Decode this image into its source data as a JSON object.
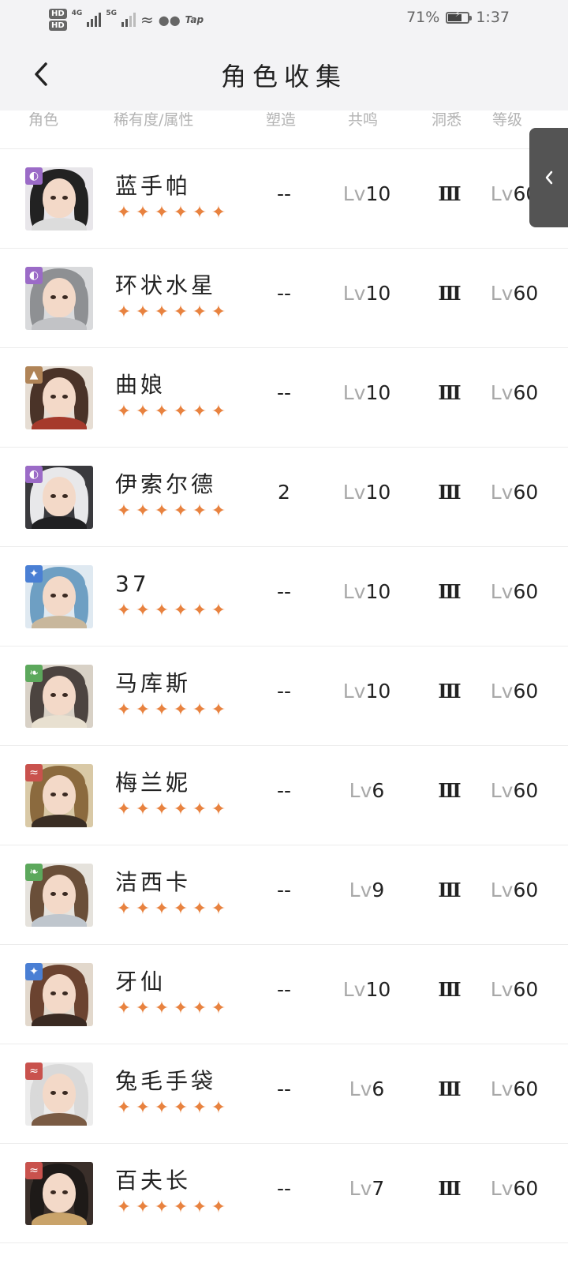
{
  "status_bar": {
    "hd1": "HD",
    "hd2": "HD",
    "net1": "4G",
    "net2": "5G",
    "tap": "Tap",
    "battery_level_percent": 71,
    "battery": "71%",
    "time": "1:37"
  },
  "nav": {
    "title": "角色收集",
    "back_icon": "chevron-left-icon"
  },
  "columns": {
    "role": "角色",
    "rarity": "稀有度/属性",
    "shape": "塑造",
    "resonance": "共鸣",
    "cave": "洞悉",
    "level": "等级"
  },
  "side_tab": {
    "icon": "chevron-left-icon"
  },
  "characters": [
    {
      "name": "蓝手帕",
      "element": "purple",
      "element_color": "#9b6bc7",
      "element_icon": "swirl-icon",
      "stars": "★★★★★★",
      "shaping": "--",
      "res_prefix": "Lv",
      "resonance": "10",
      "insight": "Ⅲ",
      "lv_prefix": "Lv",
      "level": "60",
      "palette": {
        "bg": "#e8e6ea",
        "hair": "#222222",
        "body": "#dcdcdc"
      }
    },
    {
      "name": "环状水星",
      "element": "purple",
      "element_color": "#9b6bc7",
      "element_icon": "swirl-icon",
      "stars": "★★★★★★",
      "shaping": "--",
      "res_prefix": "Lv",
      "resonance": "10",
      "insight": "Ⅲ",
      "lv_prefix": "Lv",
      "level": "60",
      "palette": {
        "bg": "#d9dadc",
        "hair": "#8e9093",
        "body": "#c2c3c6"
      }
    },
    {
      "name": "曲娘",
      "element": "brown",
      "element_color": "#b08457",
      "element_icon": "mountain-icon",
      "stars": "★★★★★★",
      "shaping": "--",
      "res_prefix": "Lv",
      "resonance": "10",
      "insight": "Ⅲ",
      "lv_prefix": "Lv",
      "level": "60",
      "palette": {
        "bg": "#e6ddd3",
        "hair": "#4a3328",
        "body": "#a63a2c"
      }
    },
    {
      "name": "伊索尔德",
      "element": "purple",
      "element_color": "#9b6bc7",
      "element_icon": "swirl-icon",
      "stars": "★★★★★★",
      "shaping": "2",
      "res_prefix": "Lv",
      "resonance": "10",
      "insight": "Ⅲ",
      "lv_prefix": "Lv",
      "level": "60",
      "palette": {
        "bg": "#3a3a3e",
        "hair": "#e8e8ea",
        "body": "#202022"
      }
    },
    {
      "name": "37",
      "element": "blue",
      "element_color": "#4a7fd4",
      "element_icon": "star-burst-icon",
      "stars": "★★★★★★",
      "shaping": "--",
      "res_prefix": "Lv",
      "resonance": "10",
      "insight": "Ⅲ",
      "lv_prefix": "Lv",
      "level": "60",
      "palette": {
        "bg": "#dfe9f1",
        "hair": "#6e9fc3",
        "body": "#c8b79c"
      }
    },
    {
      "name": "马库斯",
      "element": "green",
      "element_color": "#5ca85c",
      "element_icon": "leaf-icon",
      "stars": "★★★★★★",
      "shaping": "--",
      "res_prefix": "Lv",
      "resonance": "10",
      "insight": "Ⅲ",
      "lv_prefix": "Lv",
      "level": "60",
      "palette": {
        "bg": "#d8d1c6",
        "hair": "#4c4440",
        "body": "#e8e0d0"
      }
    },
    {
      "name": "梅兰妮",
      "element": "red",
      "element_color": "#c9524d",
      "element_icon": "flame-icon",
      "stars": "★★★★★★",
      "shaping": "--",
      "res_prefix": "Lv",
      "resonance": "6",
      "insight": "Ⅲ",
      "lv_prefix": "Lv",
      "level": "60",
      "palette": {
        "bg": "#d9c9a6",
        "hair": "#8b6a3e",
        "body": "#3a2e24"
      }
    },
    {
      "name": "洁西卡",
      "element": "green",
      "element_color": "#5ca85c",
      "element_icon": "leaf-icon",
      "stars": "★★★★★★",
      "shaping": "--",
      "res_prefix": "Lv",
      "resonance": "9",
      "insight": "Ⅲ",
      "lv_prefix": "Lv",
      "level": "60",
      "palette": {
        "bg": "#e5e2dc",
        "hair": "#6a4f39",
        "body": "#bfc6cd"
      }
    },
    {
      "name": "牙仙",
      "element": "blue",
      "element_color": "#4a7fd4",
      "element_icon": "star-burst-icon",
      "stars": "★★★★★★",
      "shaping": "--",
      "res_prefix": "Lv",
      "resonance": "10",
      "insight": "Ⅲ",
      "lv_prefix": "Lv",
      "level": "60",
      "palette": {
        "bg": "#e2d8cc",
        "hair": "#6b4330",
        "body": "#3a2a22"
      }
    },
    {
      "name": "兔毛手袋",
      "element": "red",
      "element_color": "#c9524d",
      "element_icon": "flame-icon",
      "stars": "★★★★★★",
      "shaping": "--",
      "res_prefix": "Lv",
      "resonance": "6",
      "insight": "Ⅲ",
      "lv_prefix": "Lv",
      "level": "60",
      "palette": {
        "bg": "#ececec",
        "hair": "#d9d9d9",
        "body": "#7a5b44"
      }
    },
    {
      "name": "百夫长",
      "element": "red",
      "element_color": "#c9524d",
      "element_icon": "flame-icon",
      "stars": "★★★★★★",
      "shaping": "--",
      "res_prefix": "Lv",
      "resonance": "7",
      "insight": "Ⅲ",
      "lv_prefix": "Lv",
      "level": "60",
      "palette": {
        "bg": "#3a2f2a",
        "hair": "#1e1a18",
        "body": "#c9a36a"
      }
    }
  ]
}
